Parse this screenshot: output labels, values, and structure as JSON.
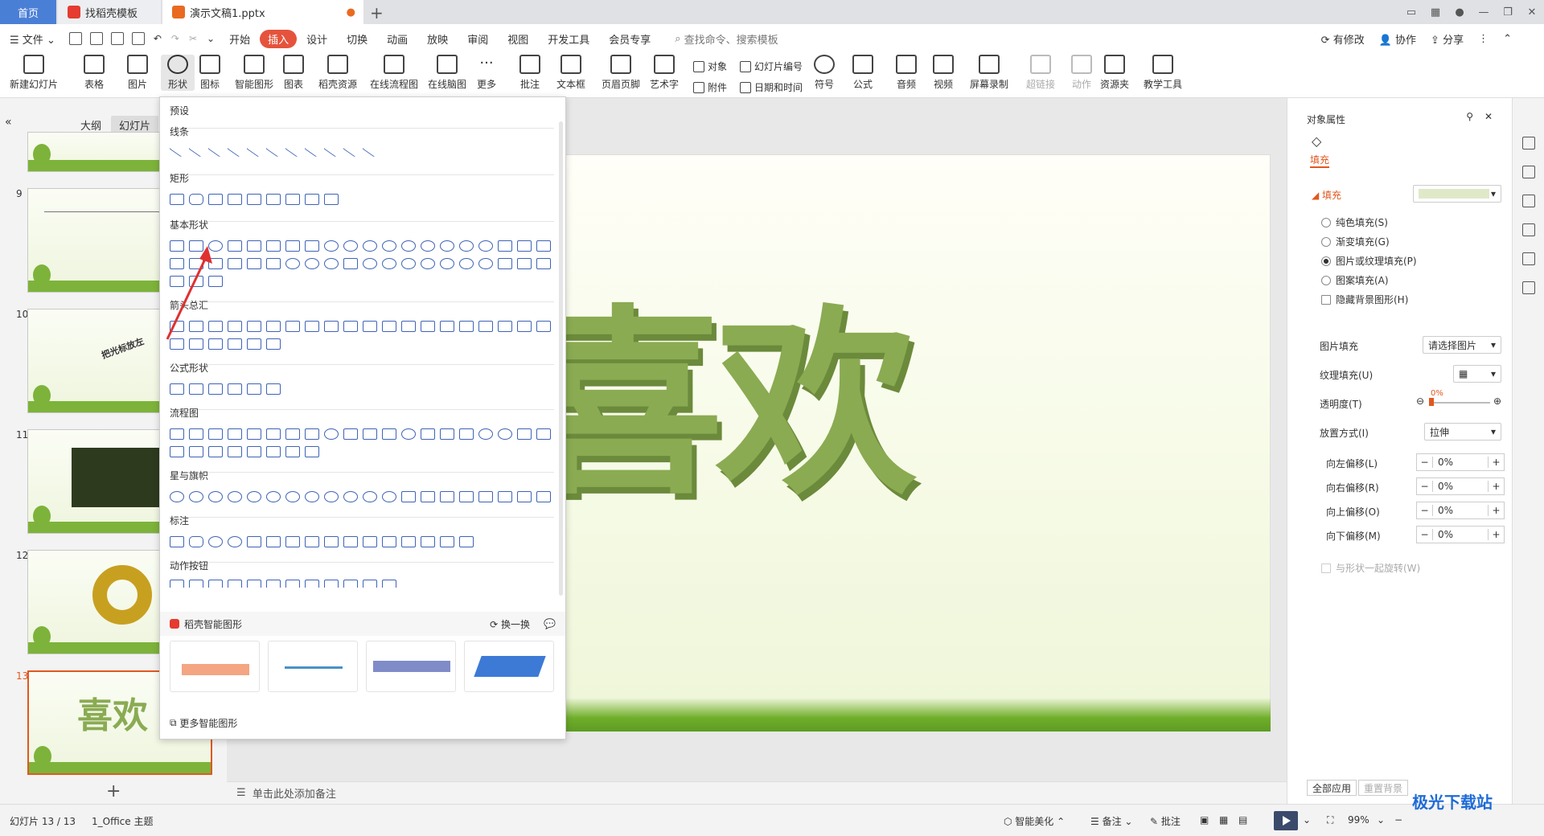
{
  "tabs": {
    "home": "首页",
    "template": "找稻壳模板",
    "doc": "演示文稿1.pptx"
  },
  "menu": {
    "file": "文件",
    "items": [
      "开始",
      "插入",
      "设计",
      "切换",
      "动画",
      "放映",
      "审阅",
      "视图",
      "开发工具",
      "会员专享"
    ],
    "search": "查找命令、搜索模板",
    "modified": "有修改",
    "collab": "协作",
    "share": "分享"
  },
  "ribbon": {
    "new_slide": "新建幻灯片",
    "table": "表格",
    "image": "图片",
    "shape": "形状",
    "icon": "图标",
    "smart": "智能图形",
    "chart": "图表",
    "docer": "稻壳资源",
    "flow": "在线流程图",
    "mind": "在线脑图",
    "more": "更多",
    "comment": "批注",
    "textbox": "文本框",
    "header": "页眉页脚",
    "art": "艺术字",
    "object": "对象",
    "attach": "附件",
    "slide_num": "幻灯片编号",
    "datetime": "日期和时间",
    "symbol": "符号",
    "formula": "公式",
    "audio": "音频",
    "video": "视频",
    "record": "屏幕录制",
    "link": "超链接",
    "action": "动作",
    "res": "资源夹",
    "teach": "教学工具"
  },
  "left": {
    "outline": "大纲",
    "slides": "幻灯片",
    "nums": [
      "9",
      "10",
      "11",
      "12",
      "13"
    ],
    "thumb10_text": "把光标放左"
  },
  "shapes": {
    "preset": "预设",
    "lines": "线条",
    "rect": "矩形",
    "basic": "基本形状",
    "arrows": "箭头总汇",
    "formula": "公式形状",
    "flow": "流程图",
    "stars": "星与旗帜",
    "callout": "标注",
    "action": "动作按钮",
    "smart": "稻壳智能图形",
    "swap": "换一换",
    "more_smart": "更多智能图形"
  },
  "slide": {
    "text": "喜欢"
  },
  "notes": "单击此处添加备注",
  "right": {
    "title": "对象属性",
    "fill_tab": "填充",
    "fill": "填充",
    "radios": [
      "纯色填充(S)",
      "渐变填充(G)",
      "图片或纹理填充(P)",
      "图案填充(A)"
    ],
    "hide_bg": "隐藏背景图形(H)",
    "pic_fill": "图片填充",
    "pic_fill_val": "请选择图片",
    "texture": "纹理填充(U)",
    "transparency": "透明度(T)",
    "transparency_val": "0%",
    "placement": "放置方式(I)",
    "placement_val": "拉伸",
    "offsets": [
      {
        "label": "向左偏移(L)",
        "v": "0%"
      },
      {
        "label": "向右偏移(R)",
        "v": "0%"
      },
      {
        "label": "向上偏移(O)",
        "v": "0%"
      },
      {
        "label": "向下偏移(M)",
        "v": "0%"
      }
    ],
    "rotate": "与形状一起旋转(W)",
    "apply_all": "全部应用",
    "reset_bg": "重置背景"
  },
  "status": {
    "slide": "幻灯片 13 / 13",
    "theme": "1_Office 主题",
    "beautify": "智能美化",
    "notes": "备注",
    "comment": "批注",
    "zoom": "99%"
  },
  "watermark": "极光下载站"
}
